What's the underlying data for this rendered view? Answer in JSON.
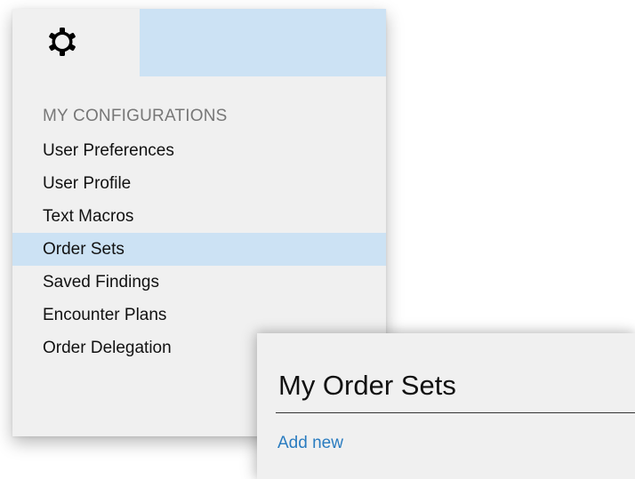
{
  "header": {
    "settings_icon": "gear-icon"
  },
  "configurations": {
    "heading": "MY CONFIGURATIONS",
    "items": [
      {
        "label": "User Preferences"
      },
      {
        "label": "User Profile"
      },
      {
        "label": "Text Macros"
      },
      {
        "label": "Order Sets",
        "selected": true
      },
      {
        "label": "Saved Findings"
      },
      {
        "label": "Encounter Plans"
      },
      {
        "label": "Order Delegation"
      }
    ]
  },
  "order_sets_panel": {
    "title": "My Order Sets",
    "add_new_label": "Add new"
  },
  "colors": {
    "panel_background": "#f0f0f0",
    "selection_highlight": "#cce2f4",
    "link": "#2a7cc0",
    "heading_gray": "#777777"
  }
}
